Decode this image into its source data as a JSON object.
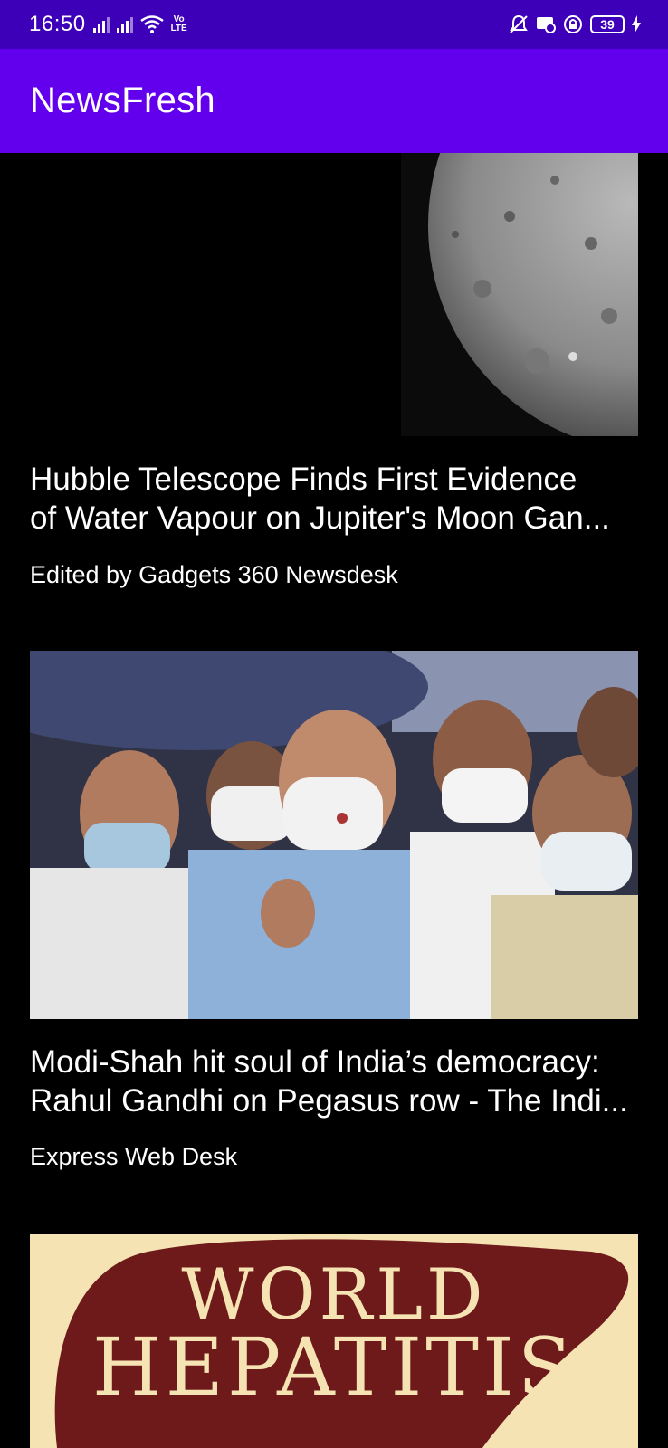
{
  "status_bar": {
    "time": "16:50",
    "volte_top": "Vo",
    "volte_bottom": "LTE",
    "battery": "39",
    "icons": [
      "signal-icon",
      "signal-icon",
      "wifi-icon",
      "volte-icon",
      "notification-off-icon",
      "chat-icon",
      "vpn-lock-icon",
      "battery-icon",
      "charging-icon"
    ]
  },
  "app_bar": {
    "title": "NewsFresh",
    "color": "#6200ee"
  },
  "articles": [
    {
      "image": "moon-surface-image",
      "headline_line1": "Hubble Telescope Finds First Evidence",
      "headline_line2": "of Water Vapour on Jupiter's Moon Gan...",
      "byline": "Edited by Gadgets 360 Newsdesk"
    },
    {
      "image": "masked-crowd-photo",
      "headline_line1": "Modi-Shah hit soul of India’s democracy:",
      "headline_line2": "Rahul Gandhi on Pegasus row - The Indi...",
      "byline": "Express Web Desk"
    },
    {
      "image": "world-hepatitis-poster",
      "poster_line1": "WORLD",
      "poster_line2": "HEPATITIS"
    }
  ]
}
